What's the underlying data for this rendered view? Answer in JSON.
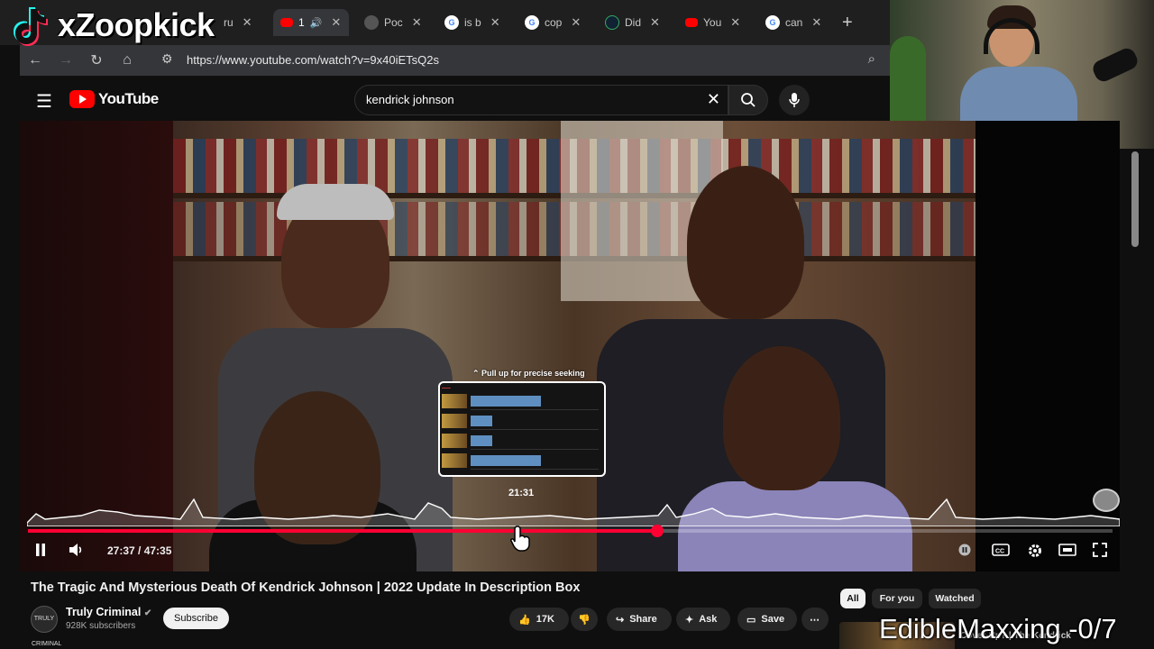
{
  "overlay": {
    "tiktok_handle": "xZoopkick",
    "ticker_text": "EdibleMaxxing -0/7"
  },
  "browser": {
    "tabs": [
      {
        "label": "ru",
        "favicon": "generic",
        "active": false
      },
      {
        "label": "1",
        "favicon": "youtube",
        "active": true
      },
      {
        "label": "Poc",
        "favicon": "globe",
        "active": false
      },
      {
        "label": "is b",
        "favicon": "google",
        "active": false
      },
      {
        "label": "cop",
        "favicon": "google",
        "active": false
      },
      {
        "label": "Did",
        "favicon": "generic",
        "active": false
      },
      {
        "label": "You",
        "favicon": "youtube",
        "active": false
      },
      {
        "label": "can",
        "favicon": "google",
        "active": false
      }
    ],
    "url": "https://www.youtube.com/watch?v=9x40iETsQ2s"
  },
  "youtube": {
    "logo_text": "YouTube",
    "search_value": "kendrick johnson",
    "player": {
      "seek_hint": "Pull up for precise seeking",
      "preview_time": "21:31",
      "time_display": "27:37 / 47:35",
      "progress_fraction": 0.58,
      "hover_fraction": 0.452
    },
    "video_title": "The Tragic And Mysterious Death Of Kendrick Johnson | 2022 Update In Description Box",
    "channel": {
      "name": "Truly Criminal",
      "subscribers": "928K subscribers",
      "avatar_text": "TRULY CRIMINAL"
    },
    "subscribe_label": "Subscribe",
    "actions": {
      "likes": "17K",
      "share": "Share",
      "ask": "Ask",
      "save": "Save"
    },
    "chips": [
      "All",
      "For you",
      "Watched"
    ],
    "recommended": {
      "title": "Cover-Up? | The Kendrick"
    }
  },
  "colors": {
    "accent": "#ff0033",
    "brand": "#ff0000"
  }
}
